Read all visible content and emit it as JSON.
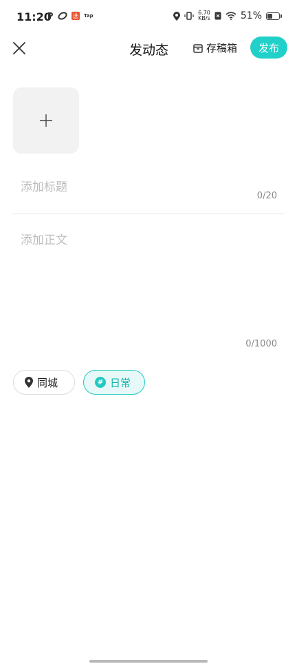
{
  "status_bar": {
    "time": "11:20",
    "net_speed_value": "6.70",
    "net_speed_unit": "KB/s",
    "battery": "51%",
    "tap_label": "Tap",
    "notif_char": "选"
  },
  "header": {
    "title": "发动态",
    "drafts_label": "存稿箱",
    "publish_label": "发布"
  },
  "editor": {
    "title_placeholder": "添加标题",
    "title_count": "0/20",
    "body_placeholder": "添加正文",
    "body_count": "0/1000"
  },
  "tags": {
    "city_label": "同城",
    "daily_label": "日常",
    "daily_icon_glyph": "#"
  },
  "colors": {
    "accent": "#21d0c8"
  }
}
